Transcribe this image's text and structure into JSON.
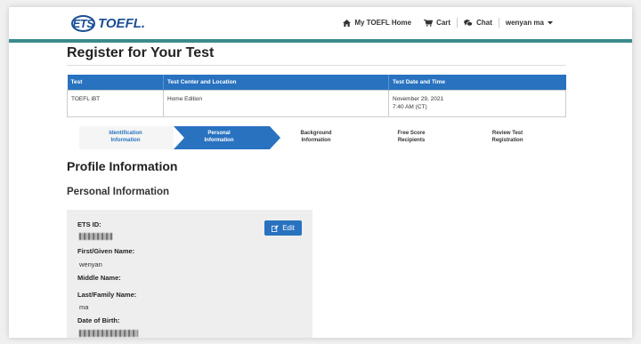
{
  "header": {
    "logo": {
      "ets": "ETS",
      "toefl": "TOEFL."
    },
    "nav": {
      "home": "My TOEFL Home",
      "cart": "Cart",
      "chat": "Chat",
      "user": "wenyan ma"
    }
  },
  "page": {
    "title": "Register for Your Test"
  },
  "registration_table": {
    "columns": [
      "Test",
      "Test Center and Location",
      "Test Date and Time"
    ],
    "row": {
      "test": "TOEFL iBT",
      "location": "Home Edition",
      "date": "November 29, 2021",
      "time": "7:40 AM (CT)"
    }
  },
  "steps": [
    {
      "line1": "Identification",
      "line2": "Information",
      "state": "completed"
    },
    {
      "line1": "Personal",
      "line2": "Information",
      "state": "active"
    },
    {
      "line1": "Background",
      "line2": "Information",
      "state": "upcoming"
    },
    {
      "line1": "Free Score",
      "line2": "Recipients",
      "state": "upcoming"
    },
    {
      "line1": "Review Test",
      "line2": "Registration",
      "state": "upcoming"
    }
  ],
  "profile": {
    "heading": "Profile Information",
    "subheading": "Personal Information",
    "edit_label": "Edit",
    "fields": {
      "ets_id_label": "ETS ID:",
      "first_name_label": "First/Given Name:",
      "first_name_value": "wenyan",
      "middle_name_label": "Middle Name:",
      "last_name_label": "Last/Family Name:",
      "last_name_value": "ma",
      "dob_label": "Date of Birth:"
    }
  },
  "colors": {
    "brand_blue": "#2872c0",
    "teal_bar": "#3a8b8b",
    "logo_blue": "#1b4f96"
  }
}
